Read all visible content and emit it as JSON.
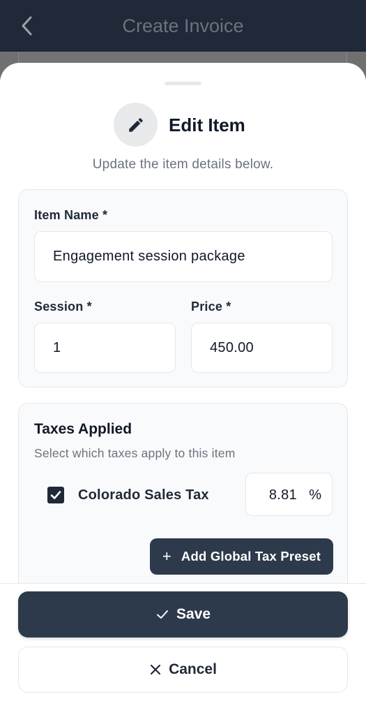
{
  "topbar": {
    "title": "Create Invoice",
    "back_icon": "chevron-left-icon"
  },
  "sheet": {
    "header": {
      "icon": "pencil-icon",
      "title": "Edit Item",
      "subtitle": "Update the item details below."
    },
    "item_details": {
      "item_name_label": "Item Name *",
      "item_name_value": "Engagement session package",
      "session_label": "Session *",
      "session_value": "1",
      "price_label": "Price *",
      "price_value": "450.00"
    },
    "taxes": {
      "title": "Taxes Applied",
      "subtitle": "Select which taxes apply to this item",
      "items": [
        {
          "name": "Colorado Sales Tax",
          "checked": true,
          "rate": "8.81",
          "unit": "%"
        }
      ],
      "add_preset_label": "Add Global Tax Preset",
      "add_preset_icon": "plus-icon"
    },
    "footer": {
      "save_label": "Save",
      "save_icon": "check-icon",
      "cancel_label": "Cancel",
      "cancel_icon": "close-icon"
    }
  },
  "colors": {
    "topbar_bg": "#1f2937",
    "primary_button": "#2d3a4b",
    "card_bg": "#f9fafb",
    "muted_text": "#6b7280"
  }
}
